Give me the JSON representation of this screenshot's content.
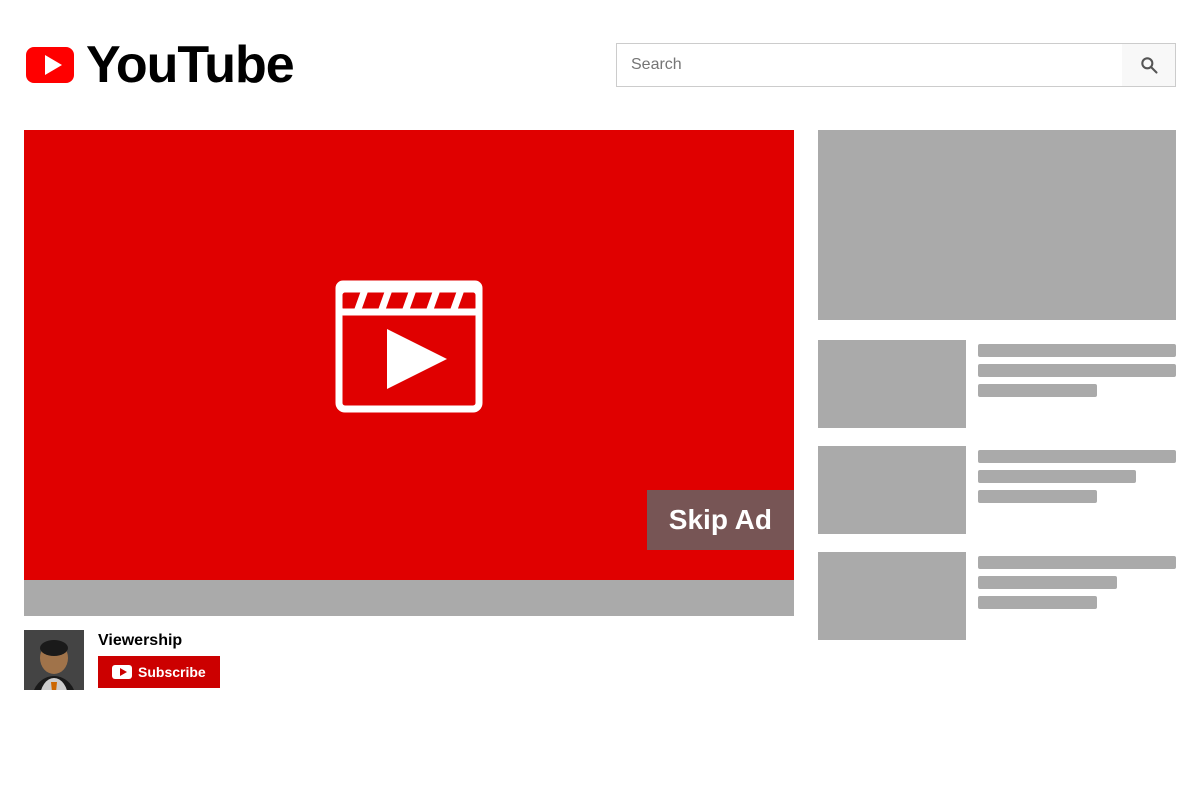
{
  "header": {
    "logo_text": "YouTube",
    "search_placeholder": "Search"
  },
  "video": {
    "skip_ad_label": "Skip Ad"
  },
  "channel": {
    "name": "Viewership",
    "subscribe_label": "Subscribe"
  },
  "sidebar": {
    "related_items": [
      {
        "id": 1
      },
      {
        "id": 2
      },
      {
        "id": 3
      }
    ]
  }
}
